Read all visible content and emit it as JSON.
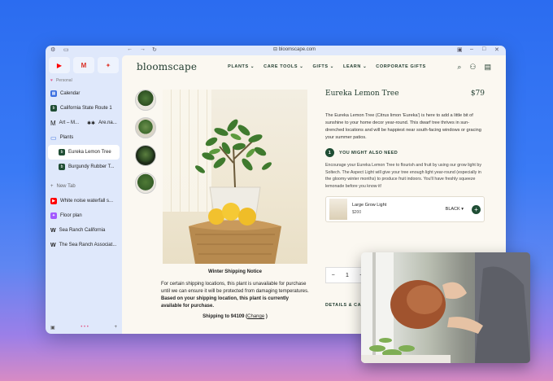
{
  "browser": {
    "url": "bloomscape.com"
  },
  "sidebar": {
    "pinned": [
      {
        "icon": "youtube-icon",
        "glyph": "▶",
        "color": "#ff0000"
      },
      {
        "icon": "gmail-icon",
        "glyph": "M",
        "color": "#d93025"
      },
      {
        "icon": "figma-icon",
        "glyph": "✦",
        "color": "#e0443a"
      }
    ],
    "space_label": "Personal",
    "items": [
      {
        "label": "Calendar",
        "icon": "calendar-icon",
        "color": "#3b6fe0"
      },
      {
        "label": "California State Route 1",
        "icon": "document-icon",
        "color": "#1f4d34"
      },
      {
        "label": "Art – M...",
        "label2": "Are.na...",
        "icon": "art-icon",
        "color": "#222"
      },
      {
        "label": "Plants",
        "icon": "folder-icon",
        "color": "#3b6fe0"
      },
      {
        "label": "Eureka Lemon Tree",
        "icon": "bloomscape-icon",
        "color": "#1f4d34"
      },
      {
        "label": "Burgundy Rubber T...",
        "icon": "bloomscape-icon",
        "color": "#1f4d34"
      }
    ],
    "new_tab": "New Tab",
    "tabs": [
      {
        "label": "White noise waterfall s...",
        "icon": "youtube-icon",
        "color": "#ff0000"
      },
      {
        "label": "Floor plan",
        "icon": "figma-icon",
        "color": "#a259ff"
      },
      {
        "label": "Sea Ranch California",
        "icon": "wiki-icon",
        "color": "#111"
      },
      {
        "label": "The Sea Ranch Associat...",
        "icon": "wiki-icon",
        "color": "#111"
      }
    ]
  },
  "site": {
    "logo": "bloomscape",
    "nav": [
      "PLANTS",
      "CARE TOOLS",
      "GIFTS",
      "LEARN",
      "CORPORATE GIFTS"
    ]
  },
  "product": {
    "name": "Eureka Lemon Tree",
    "price": "$79",
    "description": "The Eureka Lemon Tree (Citrus limon 'Eureka') is here to add a little bit of sunshine to your home decor year-round. This dwarf tree thrives in sun-drenched locations and will be happiest near south-facing windows or gracing your summer patios.",
    "step_number": "1",
    "step_title": "YOU MIGHT ALSO NEED",
    "step_text": "Encourage your Eureka Lemon Tree to flourish and fruit by using our grow light by Soltech. The Aspect Light will give your tree enough light year-round (especially in the gloomy winter months) to produce fruit indoors. You'll have freshly squeeze lemonade before you know it!",
    "upsell_name": "Large Grow Light",
    "upsell_price": "$200",
    "upsell_color": "BLACK",
    "qty": "1",
    "details_label": "DETAILS & CA..."
  },
  "shipping": {
    "title": "Winter Shipping Notice",
    "text": "For certain shipping locations, this plant is unavailable for purchase until we can ensure it will be protected from damaging temperatures.",
    "bold_text": "Based on your shipping location, this plant is currently available for purchase.",
    "ship_to": "Shipping to 94109 (",
    "change": "Change",
    "close_paren": " )"
  },
  "colors": {
    "brand_green": "#1f3b2e",
    "accent_green": "#1f4d34",
    "page_bg": "#fbf8f1"
  }
}
